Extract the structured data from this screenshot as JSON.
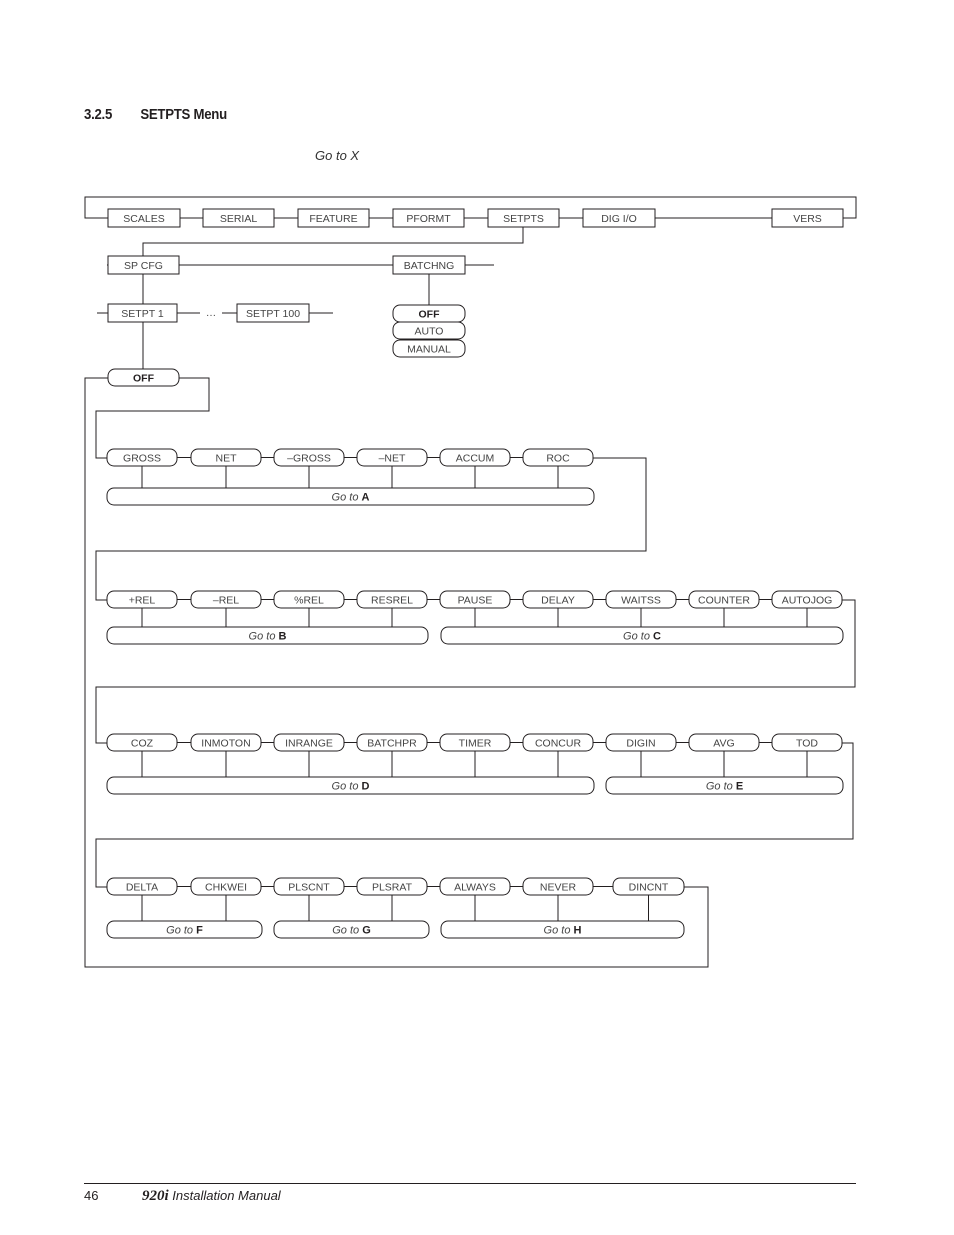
{
  "section": {
    "number": "3.2.5",
    "title": "SETPTS Menu"
  },
  "legend_note": "Go to X",
  "menu": {
    "top_level": [
      "SCALES",
      "SERIAL",
      "FEATURE",
      "PFORMT",
      "SETPTS",
      "DIG I/O",
      "VERS"
    ],
    "setpts_children": [
      "SP CFG",
      "BATCHNG"
    ],
    "spcfg_children": [
      "SETPT 1",
      "…",
      "SETPT 100"
    ],
    "batchng_options": [
      {
        "label": "OFF",
        "default": true
      },
      {
        "label": "AUTO",
        "default": false
      },
      {
        "label": "MANUAL",
        "default": false
      }
    ],
    "setpt_default": "OFF",
    "kind_rows": [
      {
        "items": [
          "GROSS",
          "NET",
          "–GROSS",
          "–NET",
          "ACCUM",
          "ROC"
        ],
        "groups": [
          {
            "prefix": "Go to",
            "target": "A"
          }
        ]
      },
      {
        "items": [
          "+REL",
          "–REL",
          "%REL",
          "RESREL",
          "PAUSE",
          "DELAY",
          "WAITSS",
          "COUNTER",
          "AUTOJOG"
        ],
        "groups": [
          {
            "prefix": "Go to",
            "target": "B"
          },
          {
            "prefix": "Go to",
            "target": "C"
          }
        ]
      },
      {
        "items": [
          "COZ",
          "INMOTON",
          "INRANGE",
          "BATCHPR",
          "TIMER",
          "CONCUR",
          "DIGIN",
          "AVG",
          "TOD"
        ],
        "groups": [
          {
            "prefix": "Go to",
            "target": "D"
          },
          {
            "prefix": "Go to",
            "target": "E"
          }
        ]
      },
      {
        "items": [
          "DELTA",
          "CHKWEI",
          "PLSCNT",
          "PLSRAT",
          "ALWAYS",
          "NEVER",
          "DINCNT"
        ],
        "groups": [
          {
            "prefix": "Go to",
            "target": "F"
          },
          {
            "prefix": "Go to",
            "target": "G"
          },
          {
            "prefix": "Go to",
            "target": "H"
          }
        ]
      }
    ]
  },
  "footer": {
    "page": "46",
    "model": "920i",
    "title": "Installation Manual"
  }
}
